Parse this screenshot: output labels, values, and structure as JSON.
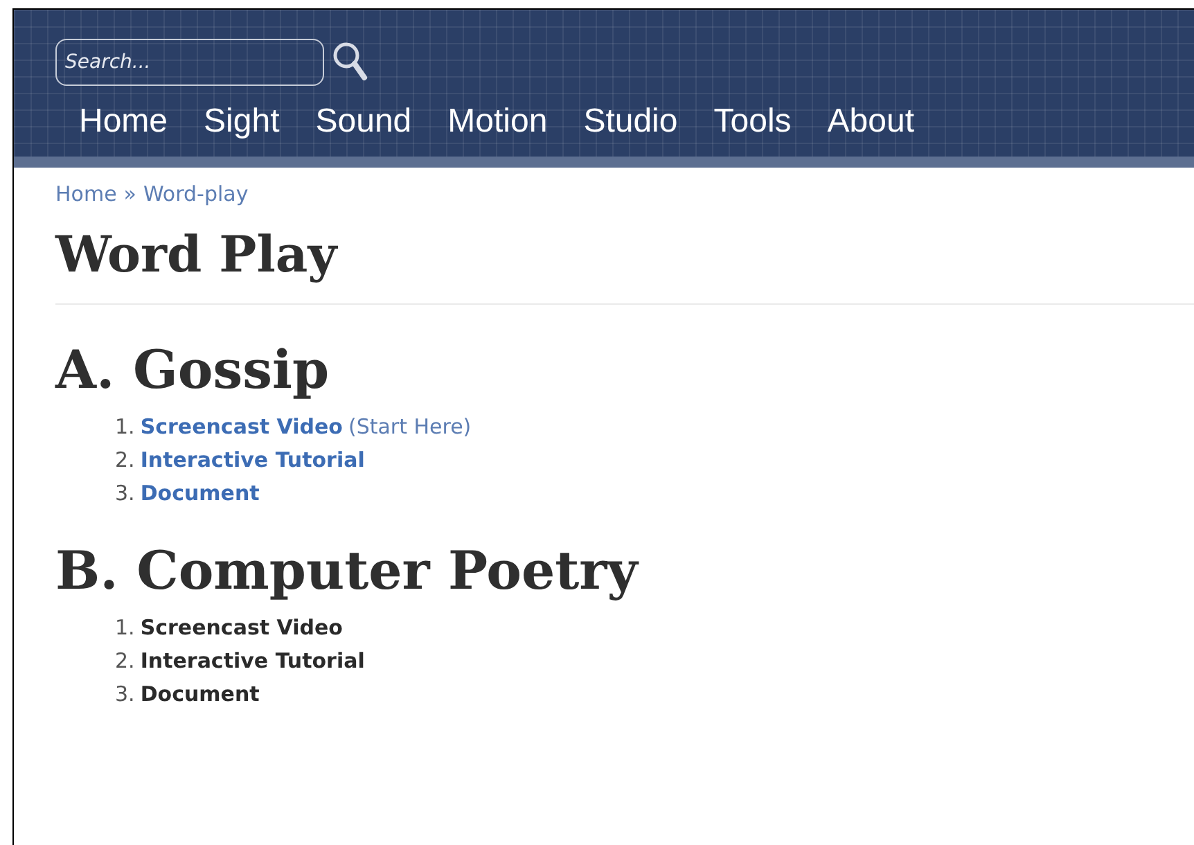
{
  "search": {
    "placeholder": "Search..."
  },
  "nav": [
    "Home",
    "Sight",
    "Sound",
    "Motion",
    "Studio",
    "Tools",
    "About"
  ],
  "breadcrumb": {
    "items": [
      "Home",
      "Word-play"
    ],
    "separator": "»"
  },
  "title": "Word Play",
  "sections": [
    {
      "heading": "A. Gossip",
      "items": [
        {
          "number": "1.",
          "label": "Screencast Video",
          "kind": "link",
          "note": "(Start Here)"
        },
        {
          "number": "2.",
          "label": "Interactive Tutorial",
          "kind": "link"
        },
        {
          "number": "3.",
          "label": "Document",
          "kind": "link"
        }
      ]
    },
    {
      "heading": "B. Computer Poetry",
      "items": [
        {
          "number": "1.",
          "label": "Screencast Video",
          "kind": "text"
        },
        {
          "number": "2.",
          "label": "Interactive Tutorial",
          "kind": "text"
        },
        {
          "number": "3.",
          "label": "Document",
          "kind": "text"
        }
      ]
    }
  ]
}
